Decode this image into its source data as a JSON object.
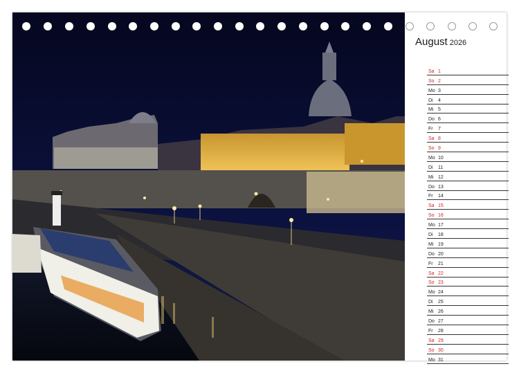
{
  "calendar": {
    "month": "August",
    "year": "2026",
    "days": [
      {
        "name": "Sa",
        "num": "1",
        "weekend": true
      },
      {
        "name": "So",
        "num": "2",
        "weekend": true
      },
      {
        "name": "Mo",
        "num": "3",
        "weekend": false
      },
      {
        "name": "Di",
        "num": "4",
        "weekend": false
      },
      {
        "name": "Mi",
        "num": "5",
        "weekend": false
      },
      {
        "name": "Do",
        "num": "6",
        "weekend": false
      },
      {
        "name": "Fr",
        "num": "7",
        "weekend": false
      },
      {
        "name": "Sa",
        "num": "8",
        "weekend": true
      },
      {
        "name": "So",
        "num": "9",
        "weekend": true
      },
      {
        "name": "Mo",
        "num": "10",
        "weekend": false
      },
      {
        "name": "Di",
        "num": "11",
        "weekend": false
      },
      {
        "name": "Mi",
        "num": "12",
        "weekend": false
      },
      {
        "name": "Do",
        "num": "13",
        "weekend": false
      },
      {
        "name": "Fr",
        "num": "14",
        "weekend": false
      },
      {
        "name": "Sa",
        "num": "15",
        "weekend": true
      },
      {
        "name": "So",
        "num": "16",
        "weekend": true
      },
      {
        "name": "Mo",
        "num": "17",
        "weekend": false
      },
      {
        "name": "Di",
        "num": "18",
        "weekend": false
      },
      {
        "name": "Mi",
        "num": "19",
        "weekend": false
      },
      {
        "name": "Do",
        "num": "20",
        "weekend": false
      },
      {
        "name": "Fr",
        "num": "21",
        "weekend": false
      },
      {
        "name": "Sa",
        "num": "22",
        "weekend": true
      },
      {
        "name": "So",
        "num": "23",
        "weekend": true
      },
      {
        "name": "Mo",
        "num": "24",
        "weekend": false
      },
      {
        "name": "Di",
        "num": "25",
        "weekend": false
      },
      {
        "name": "Mi",
        "num": "26",
        "weekend": false
      },
      {
        "name": "Do",
        "num": "27",
        "weekend": false
      },
      {
        "name": "Fr",
        "num": "28",
        "weekend": false
      },
      {
        "name": "Sa",
        "num": "29",
        "weekend": true
      },
      {
        "name": "So",
        "num": "30",
        "weekend": true
      },
      {
        "name": "Mo",
        "num": "31",
        "weekend": false
      }
    ]
  },
  "colors": {
    "weekend": "#d32020",
    "weekday": "#222222",
    "night_sky": "#0a0d2e",
    "facade_light": "#e0b04a"
  }
}
